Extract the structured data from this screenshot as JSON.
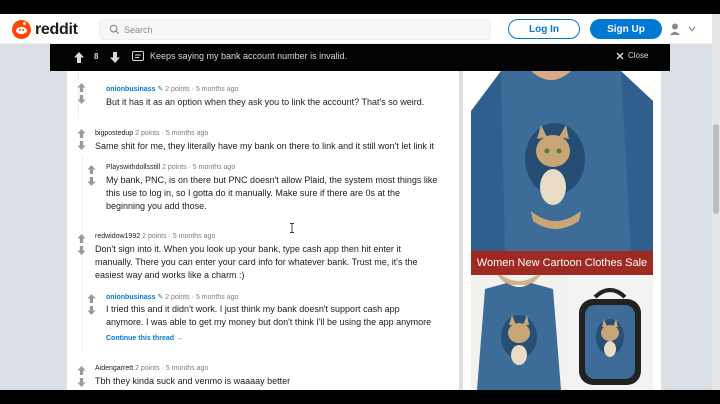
{
  "header": {
    "wordmark": "reddit",
    "search_placeholder": "Search",
    "login_label": "Log In",
    "signup_label": "Sign Up"
  },
  "postbar": {
    "vote_count": "8",
    "title": "Keeps saying my bank account number is invalid.",
    "close_label": "Close"
  },
  "comments": [
    {
      "author": "onionbusinass",
      "op": true,
      "points": "2 points",
      "time": "5 months ago",
      "body": [
        "But it has it as an option when they ask you to link the account? That's so weird."
      ]
    },
    {
      "author": "bigpostedup",
      "op": false,
      "points": "2 points",
      "time": "5 months ago",
      "body": [
        "Same shit for me, they literally have my bank on there to link and it still won't let link it"
      ]
    },
    {
      "author": "Playswithdollsstill",
      "op": false,
      "points": "2 points",
      "time": "5 months ago",
      "body": [
        "My bank, PNC, is on there but PNC doesn't allow Plaid, the system most things like",
        "this use to log in, so I gotta do it manually. Make sure if there are 0s at the",
        "beginning you add those."
      ]
    },
    {
      "author": "redwidow1992",
      "op": false,
      "points": "2 points",
      "time": "5 months ago",
      "body": [
        "Don't sign into it. When you look up your bank, type cash app then hit enter it",
        "manually. There you can enter your card info for whatever bank. Trust me, it's the",
        "easiest way and works like a charm :)"
      ]
    },
    {
      "author": "onionbusinass",
      "op": true,
      "points": "2 points",
      "time": "5 months ago",
      "body": [
        "I tried this and it didn't work. I just think my bank doesn't support cash app",
        "anymore. I was able to get my money but don't think I'll be using the app anymore"
      ]
    },
    {
      "author": "Aidengarrett",
      "op": false,
      "points": "2 points",
      "time": "5 months ago",
      "body": [
        "Tbh they kinda suck and venmo is waaaay better"
      ]
    }
  ],
  "continue_thread": "Continue this thread",
  "ad": {
    "banner": "Women New Cartoon Clothes Sale"
  },
  "colors": {
    "brand": "#ff4500",
    "accent": "#0079d3",
    "ad_banner": "#9f2a21"
  }
}
